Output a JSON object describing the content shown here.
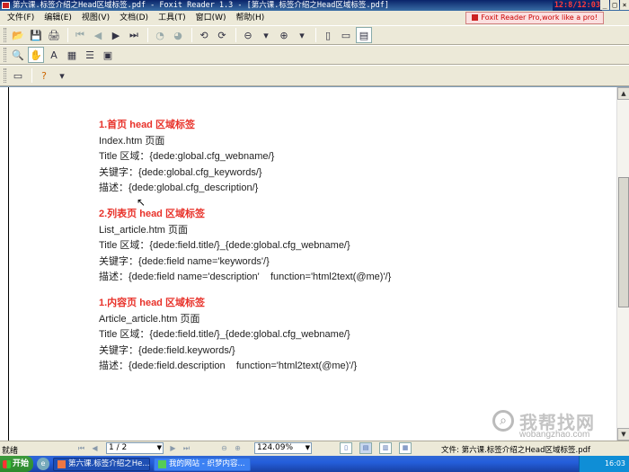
{
  "window": {
    "title": "第六课.标签介绍之Head区域标签.pdf - Foxit Reader 1.3 - [第六课.标签介绍之Head区域标签.pdf]",
    "clock": "12:8/12:03",
    "controls": [
      "_",
      "□",
      "×"
    ]
  },
  "menu": {
    "items": [
      "文件(F)",
      "编辑(E)",
      "视图(V)",
      "文档(D)",
      "工具(T)",
      "窗口(W)",
      "帮助(H)"
    ],
    "promo": "Foxit Reader Pro,work like a pro!"
  },
  "document": {
    "sections": [
      {
        "heading": "1.首页 head 区域标签",
        "lines": [
          "Index.htm 页面",
          "Title 区域：{dede:global.cfg_webname/}",
          "关键字：{dede:global.cfg_keywords/}",
          "描述：{dede:global.cfg_description/}"
        ]
      },
      {
        "heading": "2.列表页 head 区域标签",
        "lines": [
          "List_article.htm 页面",
          "Title 区域：{dede:field.title/}_{dede:global.cfg_webname/}",
          "关键字：{dede:field name='keywords'/}",
          "描述：{dede:field name='description'    function='html2text(@me)'/}"
        ]
      },
      {
        "heading": "1.内容页 head 区域标签",
        "lines": [
          "Article_article.htm 页面",
          "Title 区域：{dede:field.title/}_{dede:global.cfg_webname/}",
          "关键字：{dede:field.keywords/}",
          "描述：{dede:field.description    function='html2text(@me)'/}"
        ]
      }
    ]
  },
  "watermark": {
    "text": "我帮找网",
    "url": "wobangzhao.com"
  },
  "status": {
    "text": "就绪",
    "page": "1 / 2",
    "zoom": "124.09%",
    "file_info": "文件: 第六课.标签介绍之Head区域标签.pdf"
  },
  "taskbar": {
    "start": "开始",
    "tasks": [
      "第六课.标签介绍之He...",
      "我的网站 - 织梦内容..."
    ],
    "time": "16:03"
  },
  "colors": {
    "heading": "#e8322a",
    "clock": "#ff3b3b"
  }
}
